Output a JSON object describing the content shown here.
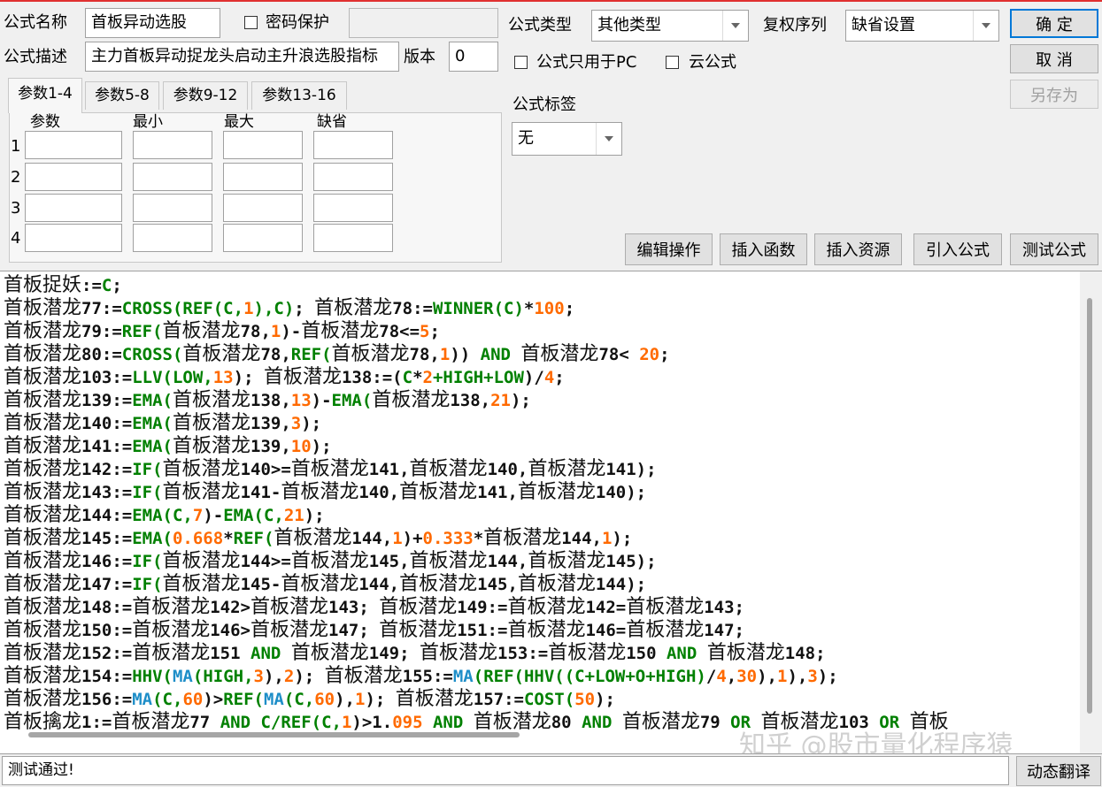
{
  "form": {
    "name_label": "公式名称",
    "name_value": "首板异动选股",
    "password_label": "密码保护",
    "password_value": "",
    "desc_label": "公式描述",
    "desc_value": "主力首板异动捉龙头启动主升浪选股指标",
    "version_label": "版本",
    "version_value": "0",
    "type_label": "公式类型",
    "type_value": "其他类型",
    "rights_label": "复权序列",
    "rights_value": "缺省设置",
    "pc_only_label": "公式只用于PC",
    "cloud_label": "云公式",
    "tag_label": "公式标签",
    "tag_value": "无"
  },
  "buttons": {
    "ok": "确 定",
    "cancel": "取 消",
    "save_as": "另存为",
    "edit_ops": "编辑操作",
    "insert_func": "插入函数",
    "insert_res": "插入资源",
    "import_formula": "引入公式",
    "test_formula": "测试公式",
    "dynamic_translate": "动态翻译"
  },
  "tabs": [
    "参数1-4",
    "参数5-8",
    "参数9-12",
    "参数13-16"
  ],
  "params": {
    "headers": [
      "参数",
      "最小",
      "最大",
      "缺省"
    ],
    "rows": [
      "1",
      "2",
      "3",
      "4"
    ]
  },
  "code_lines": [
    [
      [
        "v",
        "首板捉妖"
      ],
      [
        "o",
        ":="
      ],
      [
        "f",
        "C"
      ],
      [
        "o",
        ";"
      ]
    ],
    [
      [
        "v",
        "首板潜龙"
      ],
      [
        "o",
        "77:="
      ],
      [
        "f",
        "CROSS(REF(C,"
      ],
      [
        "n",
        "1"
      ],
      [
        "f",
        "),C)"
      ],
      [
        "o",
        "; "
      ],
      [
        "v",
        "首板潜龙"
      ],
      [
        "o",
        "78:="
      ],
      [
        "f",
        "WINNER(C)"
      ],
      [
        "o",
        "*"
      ],
      [
        "n",
        "100"
      ],
      [
        "o",
        ";"
      ]
    ],
    [
      [
        "v",
        "首板潜龙"
      ],
      [
        "o",
        "79:="
      ],
      [
        "f",
        "REF("
      ],
      [
        "v",
        "首板潜龙"
      ],
      [
        "o",
        "78,"
      ],
      [
        "n",
        "1"
      ],
      [
        "o",
        ")-"
      ],
      [
        "v",
        "首板潜龙"
      ],
      [
        "o",
        "78<="
      ],
      [
        "n",
        "5"
      ],
      [
        "o",
        ";"
      ]
    ],
    [
      [
        "v",
        "首板潜龙"
      ],
      [
        "o",
        "80:="
      ],
      [
        "f",
        "CROSS("
      ],
      [
        "v",
        "首板潜龙"
      ],
      [
        "o",
        "78,"
      ],
      [
        "f",
        "REF("
      ],
      [
        "v",
        "首板潜龙"
      ],
      [
        "o",
        "78,"
      ],
      [
        "n",
        "1"
      ],
      [
        "o",
        "))"
      ],
      [
        "f",
        " AND "
      ],
      [
        "v",
        "首板潜龙"
      ],
      [
        "o",
        "78< "
      ],
      [
        "n",
        "20"
      ],
      [
        "o",
        ";"
      ]
    ],
    [
      [
        "v",
        "首板潜龙"
      ],
      [
        "o",
        "103:="
      ],
      [
        "f",
        "LLV(LOW,"
      ],
      [
        "n",
        "13"
      ],
      [
        "o",
        "); "
      ],
      [
        "v",
        "首板潜龙"
      ],
      [
        "o",
        "138:=("
      ],
      [
        "f",
        "C"
      ],
      [
        "o",
        "*"
      ],
      [
        "n",
        "2"
      ],
      [
        "f",
        "+HIGH+LOW"
      ],
      [
        "o",
        ")/"
      ],
      [
        "n",
        "4"
      ],
      [
        "o",
        ";"
      ]
    ],
    [
      [
        "v",
        "首板潜龙"
      ],
      [
        "o",
        "139:="
      ],
      [
        "f",
        "EMA("
      ],
      [
        "v",
        "首板潜龙"
      ],
      [
        "o",
        "138,"
      ],
      [
        "n",
        "13"
      ],
      [
        "o",
        ")-"
      ],
      [
        "f",
        "EMA("
      ],
      [
        "v",
        "首板潜龙"
      ],
      [
        "o",
        "138,"
      ],
      [
        "n",
        "21"
      ],
      [
        "o",
        ");"
      ]
    ],
    [
      [
        "v",
        "首板潜龙"
      ],
      [
        "o",
        "140:="
      ],
      [
        "f",
        "EMA("
      ],
      [
        "v",
        "首板潜龙"
      ],
      [
        "o",
        "139,"
      ],
      [
        "n",
        "3"
      ],
      [
        "o",
        ");"
      ]
    ],
    [
      [
        "v",
        "首板潜龙"
      ],
      [
        "o",
        "141:="
      ],
      [
        "f",
        "EMA("
      ],
      [
        "v",
        "首板潜龙"
      ],
      [
        "o",
        "139,"
      ],
      [
        "n",
        "10"
      ],
      [
        "o",
        ");"
      ]
    ],
    [
      [
        "v",
        "首板潜龙"
      ],
      [
        "o",
        "142:="
      ],
      [
        "f",
        "IF("
      ],
      [
        "v",
        "首板潜龙"
      ],
      [
        "o",
        "140>="
      ],
      [
        "v",
        "首板潜龙"
      ],
      [
        "o",
        "141,"
      ],
      [
        "v",
        "首板潜龙"
      ],
      [
        "o",
        "140,"
      ],
      [
        "v",
        "首板潜龙"
      ],
      [
        "o",
        "141);"
      ]
    ],
    [
      [
        "v",
        "首板潜龙"
      ],
      [
        "o",
        "143:="
      ],
      [
        "f",
        "IF("
      ],
      [
        "v",
        "首板潜龙"
      ],
      [
        "o",
        "141-"
      ],
      [
        "v",
        "首板潜龙"
      ],
      [
        "o",
        "140,"
      ],
      [
        "v",
        "首板潜龙"
      ],
      [
        "o",
        "141,"
      ],
      [
        "v",
        "首板潜龙"
      ],
      [
        "o",
        "140);"
      ]
    ],
    [
      [
        "v",
        "首板潜龙"
      ],
      [
        "o",
        "144:="
      ],
      [
        "f",
        "EMA(C,"
      ],
      [
        "n",
        "7"
      ],
      [
        "o",
        ")-"
      ],
      [
        "f",
        "EMA(C,"
      ],
      [
        "n",
        "21"
      ],
      [
        "o",
        ");"
      ]
    ],
    [
      [
        "v",
        "首板潜龙"
      ],
      [
        "o",
        "145:="
      ],
      [
        "f",
        "EMA("
      ],
      [
        "n",
        "0.668"
      ],
      [
        "o",
        "*"
      ],
      [
        "f",
        "REF("
      ],
      [
        "v",
        "首板潜龙"
      ],
      [
        "o",
        "144,"
      ],
      [
        "n",
        "1"
      ],
      [
        "o",
        ")+"
      ],
      [
        "n",
        "0.333"
      ],
      [
        "o",
        "*"
      ],
      [
        "v",
        "首板潜龙"
      ],
      [
        "o",
        "144,"
      ],
      [
        "n",
        "1"
      ],
      [
        "o",
        ");"
      ]
    ],
    [
      [
        "v",
        "首板潜龙"
      ],
      [
        "o",
        "146:="
      ],
      [
        "f",
        "IF("
      ],
      [
        "v",
        "首板潜龙"
      ],
      [
        "o",
        "144>="
      ],
      [
        "v",
        "首板潜龙"
      ],
      [
        "o",
        "145,"
      ],
      [
        "v",
        "首板潜龙"
      ],
      [
        "o",
        "144,"
      ],
      [
        "v",
        "首板潜龙"
      ],
      [
        "o",
        "145);"
      ]
    ],
    [
      [
        "v",
        "首板潜龙"
      ],
      [
        "o",
        "147:="
      ],
      [
        "f",
        "IF("
      ],
      [
        "v",
        "首板潜龙"
      ],
      [
        "o",
        "145-"
      ],
      [
        "v",
        "首板潜龙"
      ],
      [
        "o",
        "144,"
      ],
      [
        "v",
        "首板潜龙"
      ],
      [
        "o",
        "145,"
      ],
      [
        "v",
        "首板潜龙"
      ],
      [
        "o",
        "144);"
      ]
    ],
    [
      [
        "v",
        "首板潜龙"
      ],
      [
        "o",
        "148:="
      ],
      [
        "v",
        "首板潜龙"
      ],
      [
        "o",
        "142>"
      ],
      [
        "v",
        "首板潜龙"
      ],
      [
        "o",
        "143; "
      ],
      [
        "v",
        "首板潜龙"
      ],
      [
        "o",
        "149:="
      ],
      [
        "v",
        "首板潜龙"
      ],
      [
        "o",
        "142="
      ],
      [
        "v",
        "首板潜龙"
      ],
      [
        "o",
        "143;"
      ]
    ],
    [
      [
        "v",
        "首板潜龙"
      ],
      [
        "o",
        "150:="
      ],
      [
        "v",
        "首板潜龙"
      ],
      [
        "o",
        "146>"
      ],
      [
        "v",
        "首板潜龙"
      ],
      [
        "o",
        "147; "
      ],
      [
        "v",
        "首板潜龙"
      ],
      [
        "o",
        "151:="
      ],
      [
        "v",
        "首板潜龙"
      ],
      [
        "o",
        "146="
      ],
      [
        "v",
        "首板潜龙"
      ],
      [
        "o",
        "147;"
      ]
    ],
    [
      [
        "v",
        "首板潜龙"
      ],
      [
        "o",
        "152:="
      ],
      [
        "v",
        "首板潜龙"
      ],
      [
        "o",
        "151"
      ],
      [
        "f",
        " AND "
      ],
      [
        "v",
        "首板潜龙"
      ],
      [
        "o",
        "149; "
      ],
      [
        "v",
        "首板潜龙"
      ],
      [
        "o",
        "153:="
      ],
      [
        "v",
        "首板潜龙"
      ],
      [
        "o",
        "150"
      ],
      [
        "f",
        " AND "
      ],
      [
        "v",
        "首板潜龙"
      ],
      [
        "o",
        "148;"
      ]
    ],
    [
      [
        "v",
        "首板潜龙"
      ],
      [
        "o",
        "154:="
      ],
      [
        "f",
        "HHV("
      ],
      [
        "l",
        "MA"
      ],
      [
        "f",
        "(HIGH,"
      ],
      [
        "n",
        "3"
      ],
      [
        "o",
        "),"
      ],
      [
        "n",
        "2"
      ],
      [
        "o",
        "); "
      ],
      [
        "v",
        "首板潜龙"
      ],
      [
        "o",
        "155:="
      ],
      [
        "l",
        "MA"
      ],
      [
        "f",
        "(REF(HHV((C+LOW+O+HIGH)"
      ],
      [
        "o",
        "/"
      ],
      [
        "n",
        "4"
      ],
      [
        "o",
        ","
      ],
      [
        "n",
        "30"
      ],
      [
        "o",
        "),"
      ],
      [
        "n",
        "1"
      ],
      [
        "o",
        "),"
      ],
      [
        "n",
        "3"
      ],
      [
        "o",
        ");"
      ]
    ],
    [
      [
        "v",
        "首板潜龙"
      ],
      [
        "o",
        "156:="
      ],
      [
        "l",
        "MA"
      ],
      [
        "f",
        "(C,"
      ],
      [
        "n",
        "60"
      ],
      [
        "o",
        ")>"
      ],
      [
        "f",
        "REF("
      ],
      [
        "l",
        "MA"
      ],
      [
        "f",
        "(C,"
      ],
      [
        "n",
        "60"
      ],
      [
        "o",
        "),"
      ],
      [
        "n",
        "1"
      ],
      [
        "o",
        "); "
      ],
      [
        "v",
        "首板潜龙"
      ],
      [
        "o",
        "157:="
      ],
      [
        "f",
        "COST("
      ],
      [
        "n",
        "50"
      ],
      [
        "o",
        ");"
      ]
    ],
    [
      [
        "v",
        "首板擒龙"
      ],
      [
        "o",
        "1:="
      ],
      [
        "v",
        "首板潜龙"
      ],
      [
        "o",
        "77"
      ],
      [
        "f",
        " AND "
      ],
      [
        "f",
        "C/REF(C,"
      ],
      [
        "n",
        "1"
      ],
      [
        "o",
        ")>1."
      ],
      [
        "n",
        "095"
      ],
      [
        "f",
        " AND "
      ],
      [
        "v",
        "首板潜龙"
      ],
      [
        "o",
        "80"
      ],
      [
        "f",
        " AND "
      ],
      [
        "v",
        "首板潜龙"
      ],
      [
        "o",
        "79"
      ],
      [
        "f",
        " OR "
      ],
      [
        "v",
        "首板潜龙"
      ],
      [
        "o",
        "103"
      ],
      [
        "f",
        " OR "
      ],
      [
        "v",
        "首板"
      ]
    ]
  ],
  "watermark": "知乎 @股市量化程序猿",
  "status": "测试通过!"
}
